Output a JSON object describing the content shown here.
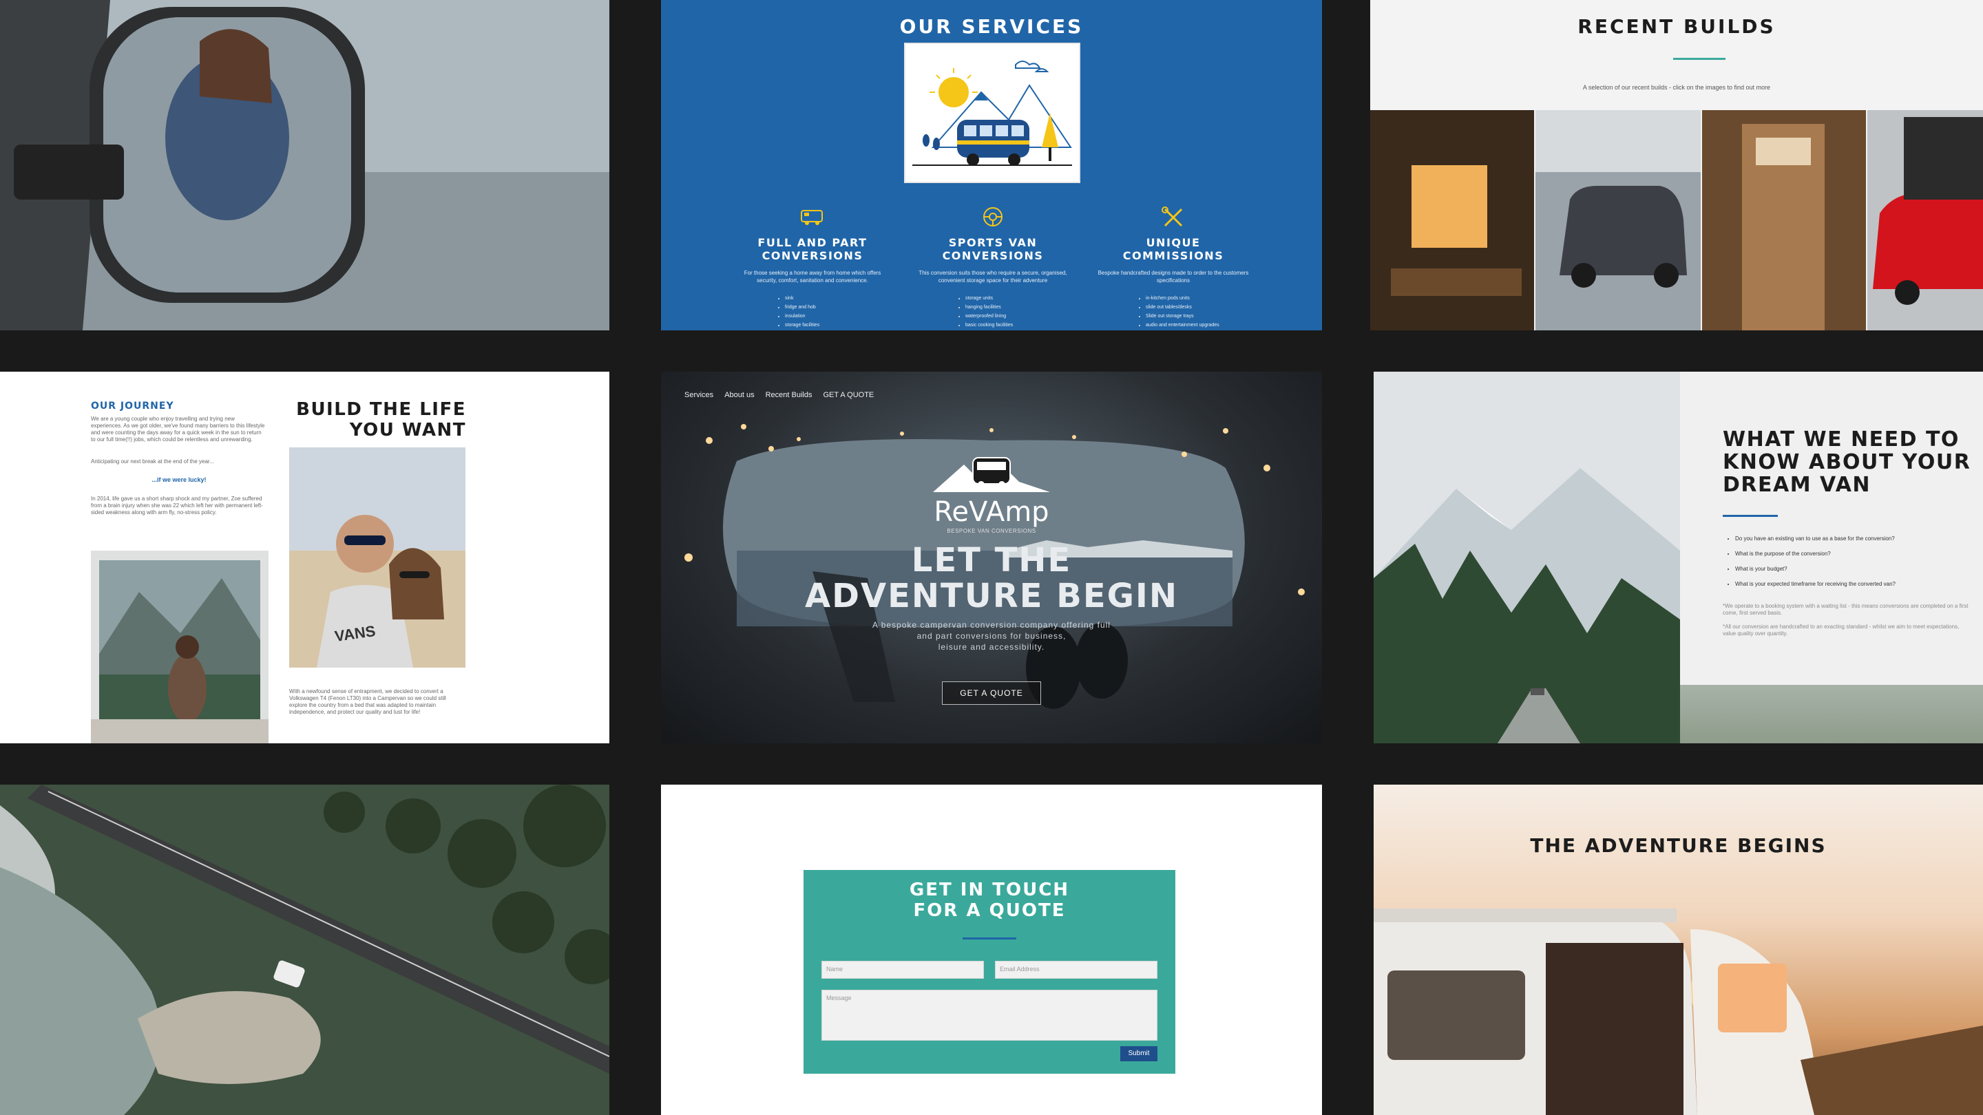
{
  "services": {
    "title": "OUR SERVICES",
    "columns": [
      {
        "icon": "campervan-icon",
        "title_line1": "FULL AND PART",
        "title_line2": "CONVERSIONS",
        "desc": "For those seeking a home away from home which offers security, comfort, sanitation and convenience.",
        "bullets": [
          "sink",
          "fridge and hob",
          "insulation",
          "storage facilities"
        ]
      },
      {
        "icon": "steering-wheel-icon",
        "title_line1": "SPORTS VAN",
        "title_line2": "CONVERSIONS",
        "desc": "This conversion suits those who require a secure, organised, convenient storage space for their adventure",
        "bullets": [
          "storage units",
          "hanging facilities",
          "waterproofed lining",
          "basic cooking facilities"
        ]
      },
      {
        "icon": "tools-icon",
        "title_line1": "UNIQUE",
        "title_line2": "COMMISSIONS",
        "desc": "Bespoke handcrafted designs made to order to the customers specifications",
        "bullets": [
          "in-kitchen pods units",
          "slide out tables/desks",
          "Slide out storage trays",
          "audio and entertainment upgrades"
        ]
      }
    ]
  },
  "builds": {
    "title": "RECENT BUILDS",
    "subtitle": "A selection of our recent builds - click on the images to find out more"
  },
  "journey": {
    "heading": "OUR JOURNEY",
    "para1": "We are a young couple who enjoy travelling and trying new experiences. As we got older, we've found many barriers to this lifestyle and were counting the days away for a quick week in the sun to return to our full time(!!) jobs, which could be relentless and unrewarding.",
    "para2": "Anticipating our next break at the end of the year...",
    "lucky": "...if we were lucky!",
    "para3": "In 2014, life gave us a short sharp shock and my partner, Zoe suffered from a brain injury when she was 22 which left her with permanent left-sided weakness along with arm fly, no-stress policy.",
    "title_line1": "BUILD THE LIFE",
    "title_line2": "YOU WANT",
    "para4": "With a newfound sense of entrapment, we decided to convert a Volkswagen T4 (Fenon LT30) into a Campervan so we could still explore the country from a bed that was adapted to maintain independence, and protect our quality and lust for life!",
    "shirt_text": "VANS"
  },
  "hero": {
    "nav": [
      "Services",
      "About us",
      "Recent Builds",
      "GET A QUOTE"
    ],
    "logo_word": "ReVAmp",
    "logo_sub": "BESPOKE VAN CONVERSIONS",
    "title_line1": "LET THE",
    "title_line2": "ADVENTURE BEGIN",
    "sub_line1": "A bespoke campervan conversion company offering full",
    "sub_line2": "and part conversions for business,",
    "sub_line3": "leisure and accessibility.",
    "cta": "GET A QUOTE"
  },
  "need": {
    "title_line1": "WHAT WE NEED TO",
    "title_line2": "KNOW ABOUT YOUR",
    "title_line3": "DREAM VAN",
    "bullets": [
      "Do you have an existing van to use as a base for the conversion?",
      "What is the purpose of the conversion?",
      "What is your budget?",
      "What is your expected timeframe for receiving the converted van?"
    ],
    "note1": "*We operate to a booking system with a waiting list - this means conversions are completed on a first come, first served basis.",
    "note2": "*All our conversion are handcrafted to an exacting standard - whilst we aim to meet expectations, value quality over quantity."
  },
  "contact": {
    "title_line1": "GET IN TOUCH",
    "title_line2": "FOR A QUOTE",
    "name_placeholder": "Name",
    "email_placeholder": "Email Address",
    "message_placeholder": "Message",
    "submit": "Submit"
  },
  "begins": {
    "title": "THE ADVENTURE BEGINS"
  },
  "colors": {
    "services_blue": "#2065a8",
    "teal": "#3aa99b",
    "dark_bg": "#1a1a1a"
  }
}
